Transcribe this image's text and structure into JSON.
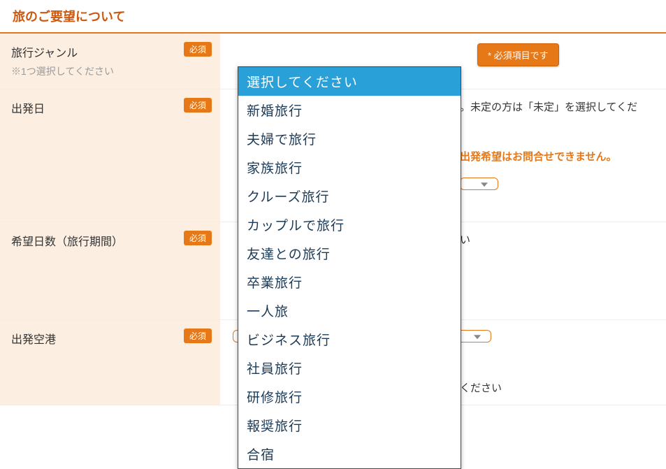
{
  "section_title": "旅のご要望について",
  "rows": {
    "genre": {
      "label": "旅行ジャンル",
      "hint": "※1つ選択してください",
      "required": "必須",
      "validation": "* 必須項目です"
    },
    "departure_date": {
      "label": "出発日",
      "required": "必須",
      "note_fragment": "。未定の方は「未定」を選択してくだ",
      "warn_fragment": "出発希望はお問合せできません。"
    },
    "duration": {
      "label": "希望日数（旅行期間）",
      "required": "必須",
      "value_fragment": "い"
    },
    "airport": {
      "label": "出発空港",
      "required": "必須",
      "subnote_fragment": "ください"
    }
  },
  "dropdown": {
    "options": [
      "選択してください",
      "新婚旅行",
      "夫婦で旅行",
      "家族旅行",
      "クルーズ旅行",
      "カップルで旅行",
      "友達との旅行",
      "卒業旅行",
      "一人旅",
      "ビジネス旅行",
      "社員旅行",
      "研修旅行",
      "報奨旅行",
      "合宿"
    ]
  }
}
